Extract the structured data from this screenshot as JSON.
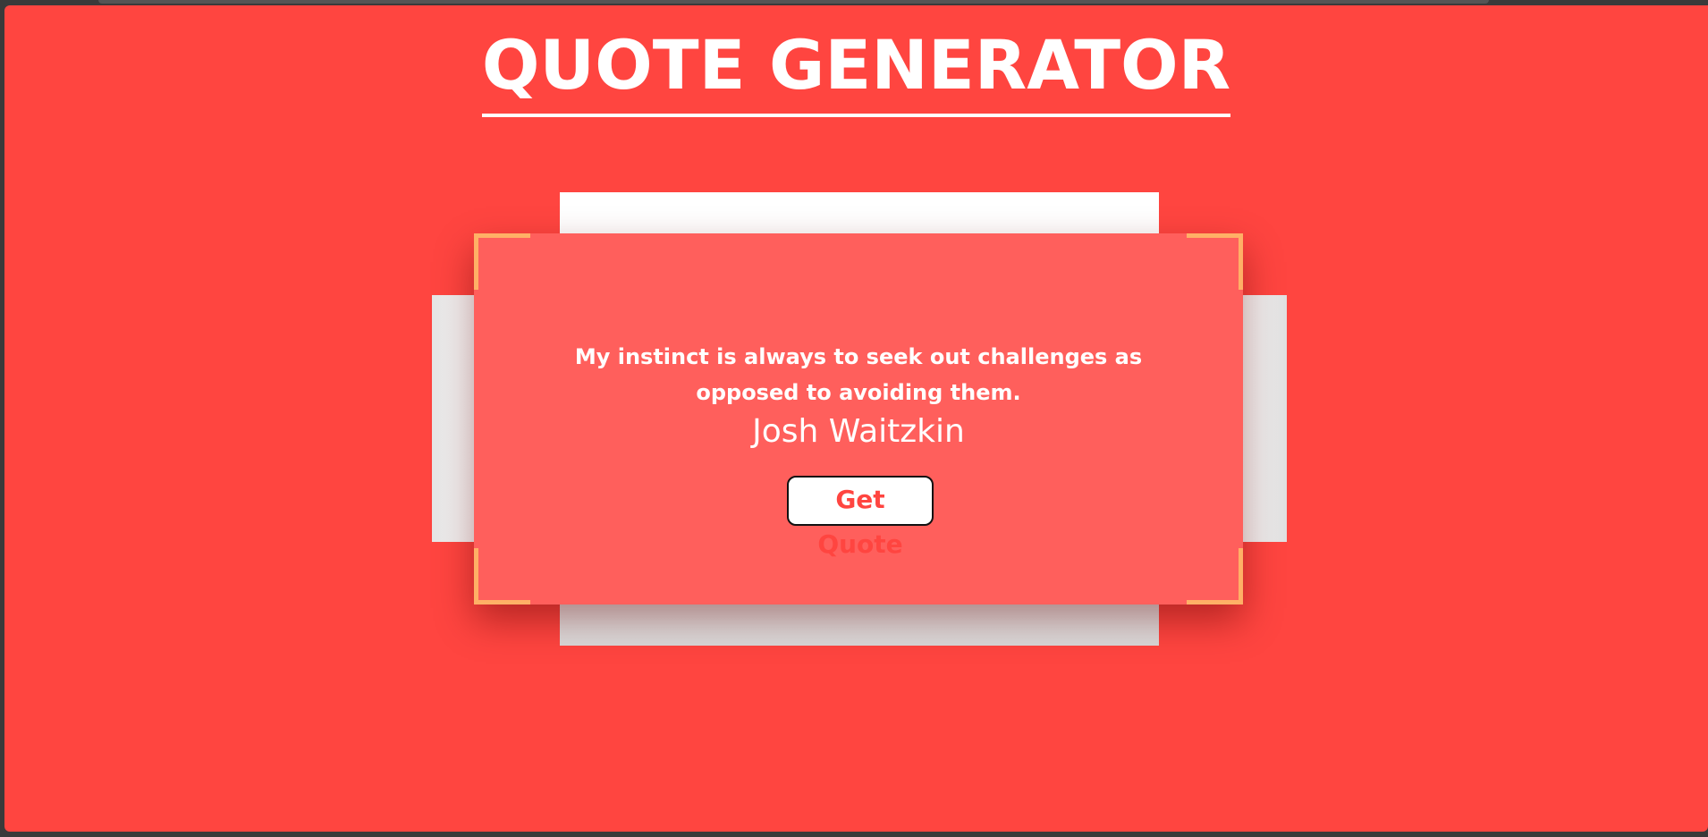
{
  "app": {
    "title": "QUOTE GENERATOR"
  },
  "quote": {
    "text": "My instinct is always to seek out challenges as opposed to avoiding them.",
    "author": "Josh Waitzkin"
  },
  "actions": {
    "get_quote_label": "Get Quote"
  },
  "colors": {
    "background": "#ff4540",
    "card": "#ff5f5c",
    "corner_accent": "#ffb066",
    "button_text": "#ff4540",
    "text": "#ffffff"
  }
}
